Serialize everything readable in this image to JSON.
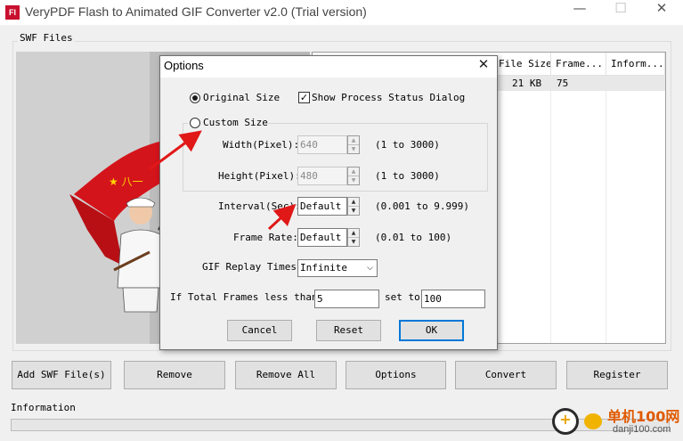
{
  "window": {
    "icon_text": "Fl",
    "title": "VeryPDF Flash to Animated GIF Converter v2.0 (Trial version)",
    "controls": {
      "minimize": "—",
      "maximize": "☐",
      "close": "✕"
    }
  },
  "swf_files": {
    "group_label": "SWF Files",
    "columns": [
      "File Size",
      "Frame...",
      "Inform..."
    ],
    "rows": [
      {
        "file_size": "21 KB",
        "frames": "75",
        "information": ""
      }
    ]
  },
  "buttons": {
    "add": "Add SWF File(s)",
    "remove": "Remove",
    "remove_all": "Remove All",
    "options": "Options",
    "convert": "Convert",
    "register": "Register"
  },
  "information_label": "Information",
  "dialog": {
    "title": "Options",
    "close": "✕",
    "original_size": {
      "label": "Original Size",
      "selected": true
    },
    "show_status": {
      "label": "Show Process Status Dialog",
      "checked": true,
      "mark": "✓"
    },
    "custom_size": {
      "label": "Custom Size",
      "selected": false
    },
    "width": {
      "label": "Width(Pixel):",
      "value": "640",
      "range": "(1 to 3000)"
    },
    "height": {
      "label": "Height(Pixel):",
      "value": "480",
      "range": "(1 to 3000)"
    },
    "interval": {
      "label": "Interval(Sec):",
      "value": "Default",
      "range": "(0.001 to 9.999)"
    },
    "frame_rate": {
      "label": "Frame Rate:",
      "value": "Default",
      "range": "(0.01 to 100)"
    },
    "replay": {
      "label": "GIF Replay Times:",
      "value": "Infinite"
    },
    "total_frames": {
      "label": "If Total Frames less than",
      "value": "5",
      "set_to_label": "set to",
      "set_to_value": "100"
    },
    "buttons": {
      "cancel": "Cancel",
      "reset": "Reset",
      "ok": "OK"
    }
  },
  "watermark": {
    "text": "单机100网",
    "url": "danji100.com"
  },
  "colors": {
    "arrow": "#e01818",
    "flag": "#d4141b",
    "accent": "#0078d7"
  }
}
